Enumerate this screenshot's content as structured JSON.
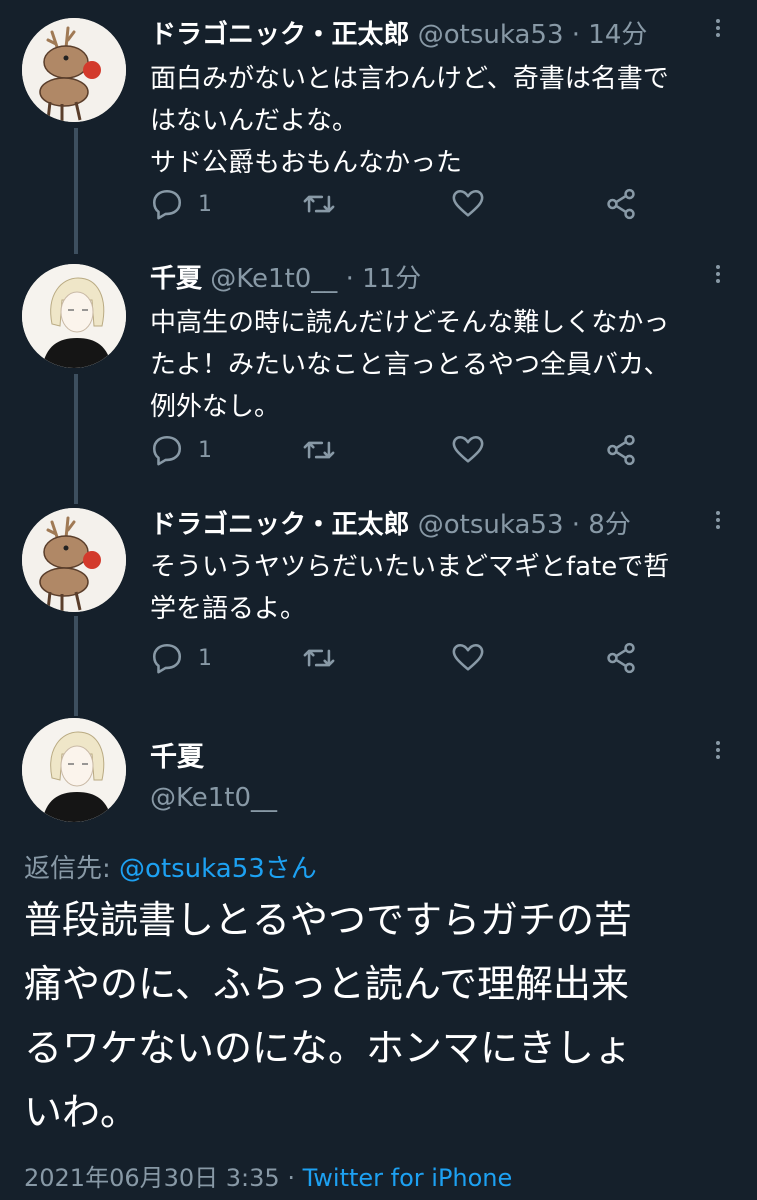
{
  "colors": {
    "background": "#15202b",
    "text": "#ffffff",
    "muted": "#8899a6",
    "link": "#1da1f2",
    "thread_line": "#3d4f5f"
  },
  "tweets": [
    {
      "name": "ドラゴニック・正太郎",
      "handle": "@otsuka53",
      "sep": " · ",
      "time": "14分",
      "avatar": "reindeer",
      "lines": [
        "面白みがないとは言わんけど、奇書は名書で",
        "はないんだよな。",
        "サド公爵もおもんなかった"
      ],
      "reply_count": "1"
    },
    {
      "name": "千夏",
      "handle": "@Ke1t0__",
      "sep": " · ",
      "time": "11分",
      "avatar": "girl",
      "lines": [
        "中高生の時に読んだけどそんな難しくなかっ",
        "たよ！みたいなこと言っとるやつ全員バカ、",
        "例外なし。"
      ],
      "reply_count": "1"
    },
    {
      "name": "ドラゴニック・正太郎",
      "handle": "@otsuka53",
      "sep": " · ",
      "time": "8分",
      "avatar": "reindeer",
      "lines": [
        "そういうヤツらだいたいまどマギとfateで哲",
        "学を語るよ。"
      ],
      "reply_count": "1"
    }
  ],
  "main_tweet": {
    "name": "千夏",
    "handle": "@Ke1t0__",
    "reply_prefix": "返信先: ",
    "reply_target": "@otsuka53さん",
    "lines": [
      "普段読書しとるやつですらガチの苦",
      "痛やのに、ふらっと読んで理解出来",
      "るワケないのにな。ホンマにきしょ",
      "いわ。"
    ],
    "date": "2021年06月30日 3:35",
    "sep": " · ",
    "source": "Twitter for iPhone"
  },
  "icons": {
    "reply": "reply-icon",
    "retweet": "retweet-icon",
    "like": "heart-icon",
    "share": "share-icon",
    "more": "more-vert-icon"
  }
}
